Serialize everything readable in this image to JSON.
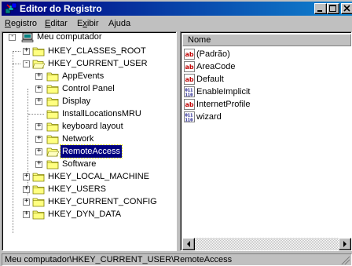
{
  "window": {
    "title": "Editor do Registro"
  },
  "menu": [
    "Registro",
    "Editar",
    "Exibir",
    "Ajuda"
  ],
  "menu_access_keys": [
    "R",
    "E",
    "x",
    "j"
  ],
  "tree": {
    "root": "Meu computador",
    "hkcr": "HKEY_CLASSES_ROOT",
    "hkcu": "HKEY_CURRENT_USER",
    "hkcu_children": [
      "AppEvents",
      "Control Panel",
      "Display",
      "InstallLocationsMRU",
      "keyboard layout",
      "Network",
      "RemoteAccess",
      "Software"
    ],
    "hklm": "HKEY_LOCAL_MACHINE",
    "hku": "HKEY_USERS",
    "hkcc": "HKEY_CURRENT_CONFIG",
    "hkdd": "HKEY_DYN_DATA",
    "selected": "RemoteAccess"
  },
  "list": {
    "column_name": "Nome",
    "values": [
      {
        "name": "(Padrão)",
        "type": "string"
      },
      {
        "name": "AreaCode",
        "type": "string"
      },
      {
        "name": "Default",
        "type": "string"
      },
      {
        "name": "EnableImplicit",
        "type": "binary"
      },
      {
        "name": "InternetProfile",
        "type": "string"
      },
      {
        "name": "wizard",
        "type": "binary"
      }
    ]
  },
  "status": "Meu computador\\HKEY_CURRENT_USER\\RemoteAccess",
  "colors": {
    "title_start": "#000080",
    "title_end": "#1084d0",
    "selection": "#000080",
    "face": "#c0c0c0"
  }
}
